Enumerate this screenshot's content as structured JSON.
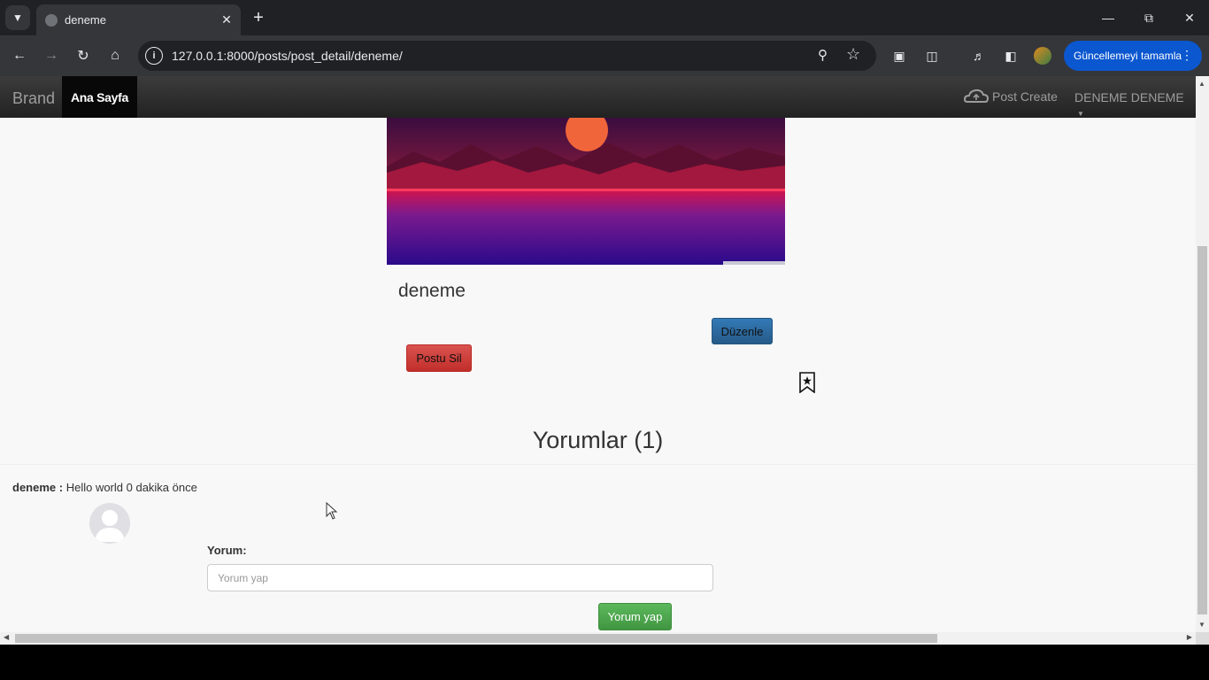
{
  "browser": {
    "tab": {
      "title": "deneme"
    },
    "address": {
      "url": "127.0.0.1:8000/posts/post_detail/deneme/"
    },
    "update_button": {
      "label": "Güncellemeyi tamamla"
    }
  },
  "navbar": {
    "brand": "Brand",
    "home": "Ana Sayfa",
    "post_create": "Post Create",
    "user_menu": "DENEME DENEME"
  },
  "post": {
    "title": "deneme",
    "edit_label": "Düzenle",
    "delete_label": "Postu Sil"
  },
  "comments": {
    "heading": "Yorumlar (1)",
    "items": [
      {
        "author": "deneme :",
        "text": "Hello world 0 dakika önce"
      }
    ],
    "form": {
      "label": "Yorum:",
      "placeholder": "Yorum yap",
      "value": "",
      "submit_label": "Yorum yap"
    }
  },
  "colors": {
    "primary": "#337ab7",
    "danger": "#d9534f",
    "success": "#5cb85c",
    "navbar": "#222222",
    "chrome_accent": "#0b57d0"
  }
}
